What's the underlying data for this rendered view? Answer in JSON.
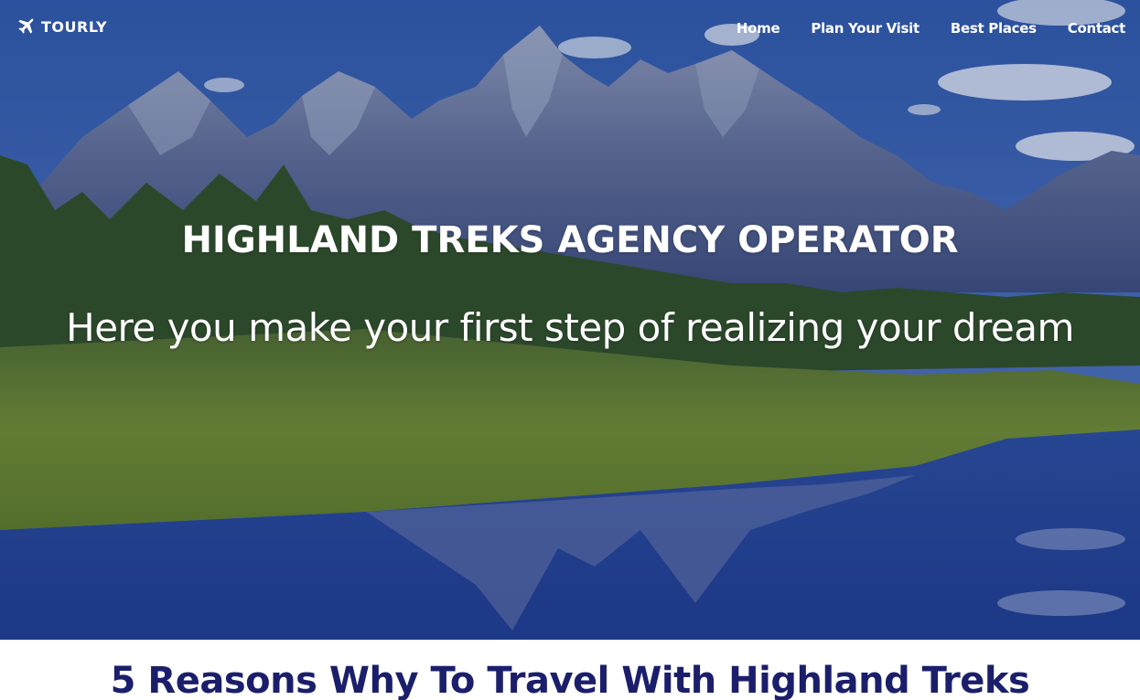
{
  "brand": {
    "name": "TOURLY",
    "icon": "airplane-icon"
  },
  "nav": {
    "items": [
      {
        "label": "Home"
      },
      {
        "label": "Plan Your Visit"
      },
      {
        "label": "Best Places"
      },
      {
        "label": "Contact"
      }
    ]
  },
  "hero": {
    "title": "HIGHLAND TREKS AGENCY OPERATOR",
    "subtitle": "Here you make your first step of realizing your dream",
    "background": "mountain-lake-landscape"
  },
  "reasons": {
    "heading": "5 Reasons Why To Travel With Highland Treks"
  },
  "colors": {
    "heading": "#1b1f6b",
    "hero_text": "#ffffff",
    "sky": "#3b5fa6"
  }
}
